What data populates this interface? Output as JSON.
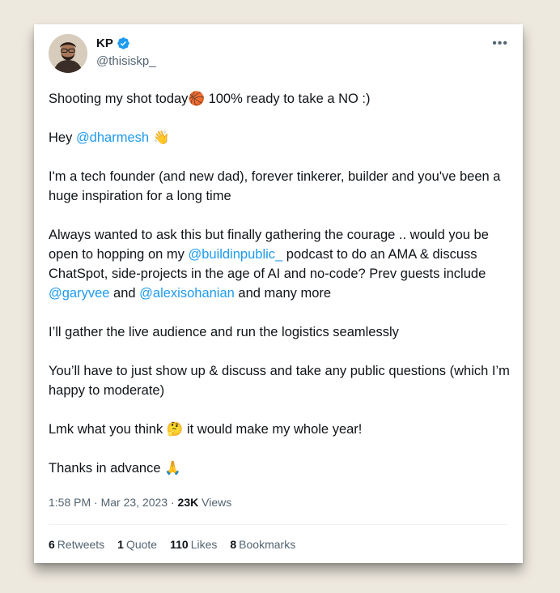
{
  "author": {
    "name": "KP",
    "handle": "@thisiskp_",
    "avatar_icon": "avatar-photo",
    "verified_color": "#1d9bf0"
  },
  "more_label": "•••",
  "tweet": {
    "p1": {
      "a": "Shooting my shot today",
      "emoji": "🏀",
      "b": " 100% ready to take a NO :)"
    },
    "p2": {
      "a": "Hey ",
      "mention": "@dharmesh",
      "emoji": " 👋"
    },
    "p3": "I'm a tech founder (and new dad), forever tinkerer, builder and you've been a huge inspiration for a long time",
    "p4": {
      "a": "Always wanted to ask this but finally gathering the courage .. would you be open to hopping on my ",
      "m1": "@buildinpublic_",
      "b": " podcast to do an AMA & discuss ChatSpot, side-projects in the age of AI and no-code? Prev guests include ",
      "m2": "@garyvee",
      "c": " and ",
      "m3": "@alexisohanian",
      "d": " and many more"
    },
    "p5": "I’ll gather the live audience and run the logistics seamlessly",
    "p6": "You’ll have to just show up & discuss and take any public questions (which I’m happy to moderate)",
    "p7": {
      "a": "Lmk what you think ",
      "emoji": "🤔",
      "b": " it would make my whole year!"
    },
    "p8": {
      "a": "Thanks in advance ",
      "emoji": "🙏"
    }
  },
  "meta": {
    "time": "1:58 PM",
    "sep1": " · ",
    "date": "Mar 23, 2023",
    "sep2": " · ",
    "views_count": "23K",
    "views_label": " Views"
  },
  "stats": {
    "retweets": {
      "count": "6",
      "label": "Retweets"
    },
    "quotes": {
      "count": "1",
      "label": "Quote"
    },
    "likes": {
      "count": "110",
      "label": "Likes"
    },
    "bookmarks": {
      "count": "8",
      "label": "Bookmarks"
    }
  },
  "colors": {
    "mention": "#1d9bf0",
    "text": "#0f1419",
    "secondary": "#536471",
    "background": "#eee9df"
  }
}
